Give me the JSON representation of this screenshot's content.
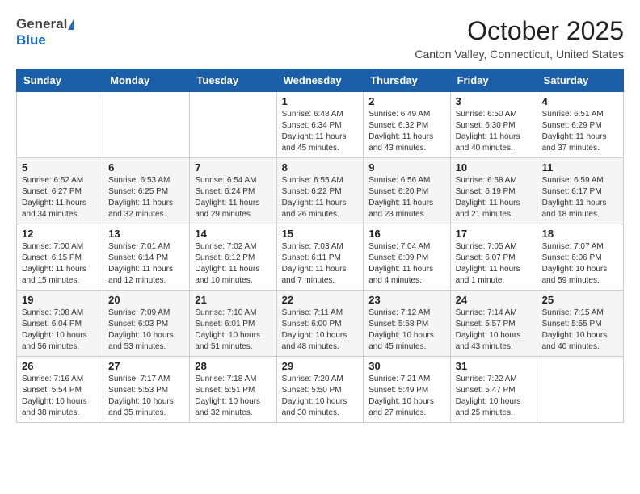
{
  "header": {
    "logo_general": "General",
    "logo_blue": "Blue",
    "month_title": "October 2025",
    "location": "Canton Valley, Connecticut, United States"
  },
  "weekdays": [
    "Sunday",
    "Monday",
    "Tuesday",
    "Wednesday",
    "Thursday",
    "Friday",
    "Saturday"
  ],
  "weeks": [
    [
      {
        "day": "",
        "info": ""
      },
      {
        "day": "",
        "info": ""
      },
      {
        "day": "",
        "info": ""
      },
      {
        "day": "1",
        "info": "Sunrise: 6:48 AM\nSunset: 6:34 PM\nDaylight: 11 hours and 45 minutes."
      },
      {
        "day": "2",
        "info": "Sunrise: 6:49 AM\nSunset: 6:32 PM\nDaylight: 11 hours and 43 minutes."
      },
      {
        "day": "3",
        "info": "Sunrise: 6:50 AM\nSunset: 6:30 PM\nDaylight: 11 hours and 40 minutes."
      },
      {
        "day": "4",
        "info": "Sunrise: 6:51 AM\nSunset: 6:29 PM\nDaylight: 11 hours and 37 minutes."
      }
    ],
    [
      {
        "day": "5",
        "info": "Sunrise: 6:52 AM\nSunset: 6:27 PM\nDaylight: 11 hours and 34 minutes."
      },
      {
        "day": "6",
        "info": "Sunrise: 6:53 AM\nSunset: 6:25 PM\nDaylight: 11 hours and 32 minutes."
      },
      {
        "day": "7",
        "info": "Sunrise: 6:54 AM\nSunset: 6:24 PM\nDaylight: 11 hours and 29 minutes."
      },
      {
        "day": "8",
        "info": "Sunrise: 6:55 AM\nSunset: 6:22 PM\nDaylight: 11 hours and 26 minutes."
      },
      {
        "day": "9",
        "info": "Sunrise: 6:56 AM\nSunset: 6:20 PM\nDaylight: 11 hours and 23 minutes."
      },
      {
        "day": "10",
        "info": "Sunrise: 6:58 AM\nSunset: 6:19 PM\nDaylight: 11 hours and 21 minutes."
      },
      {
        "day": "11",
        "info": "Sunrise: 6:59 AM\nSunset: 6:17 PM\nDaylight: 11 hours and 18 minutes."
      }
    ],
    [
      {
        "day": "12",
        "info": "Sunrise: 7:00 AM\nSunset: 6:15 PM\nDaylight: 11 hours and 15 minutes."
      },
      {
        "day": "13",
        "info": "Sunrise: 7:01 AM\nSunset: 6:14 PM\nDaylight: 11 hours and 12 minutes."
      },
      {
        "day": "14",
        "info": "Sunrise: 7:02 AM\nSunset: 6:12 PM\nDaylight: 11 hours and 10 minutes."
      },
      {
        "day": "15",
        "info": "Sunrise: 7:03 AM\nSunset: 6:11 PM\nDaylight: 11 hours and 7 minutes."
      },
      {
        "day": "16",
        "info": "Sunrise: 7:04 AM\nSunset: 6:09 PM\nDaylight: 11 hours and 4 minutes."
      },
      {
        "day": "17",
        "info": "Sunrise: 7:05 AM\nSunset: 6:07 PM\nDaylight: 11 hours and 1 minute."
      },
      {
        "day": "18",
        "info": "Sunrise: 7:07 AM\nSunset: 6:06 PM\nDaylight: 10 hours and 59 minutes."
      }
    ],
    [
      {
        "day": "19",
        "info": "Sunrise: 7:08 AM\nSunset: 6:04 PM\nDaylight: 10 hours and 56 minutes."
      },
      {
        "day": "20",
        "info": "Sunrise: 7:09 AM\nSunset: 6:03 PM\nDaylight: 10 hours and 53 minutes."
      },
      {
        "day": "21",
        "info": "Sunrise: 7:10 AM\nSunset: 6:01 PM\nDaylight: 10 hours and 51 minutes."
      },
      {
        "day": "22",
        "info": "Sunrise: 7:11 AM\nSunset: 6:00 PM\nDaylight: 10 hours and 48 minutes."
      },
      {
        "day": "23",
        "info": "Sunrise: 7:12 AM\nSunset: 5:58 PM\nDaylight: 10 hours and 45 minutes."
      },
      {
        "day": "24",
        "info": "Sunrise: 7:14 AM\nSunset: 5:57 PM\nDaylight: 10 hours and 43 minutes."
      },
      {
        "day": "25",
        "info": "Sunrise: 7:15 AM\nSunset: 5:55 PM\nDaylight: 10 hours and 40 minutes."
      }
    ],
    [
      {
        "day": "26",
        "info": "Sunrise: 7:16 AM\nSunset: 5:54 PM\nDaylight: 10 hours and 38 minutes."
      },
      {
        "day": "27",
        "info": "Sunrise: 7:17 AM\nSunset: 5:53 PM\nDaylight: 10 hours and 35 minutes."
      },
      {
        "day": "28",
        "info": "Sunrise: 7:18 AM\nSunset: 5:51 PM\nDaylight: 10 hours and 32 minutes."
      },
      {
        "day": "29",
        "info": "Sunrise: 7:20 AM\nSunset: 5:50 PM\nDaylight: 10 hours and 30 minutes."
      },
      {
        "day": "30",
        "info": "Sunrise: 7:21 AM\nSunset: 5:49 PM\nDaylight: 10 hours and 27 minutes."
      },
      {
        "day": "31",
        "info": "Sunrise: 7:22 AM\nSunset: 5:47 PM\nDaylight: 10 hours and 25 minutes."
      },
      {
        "day": "",
        "info": ""
      }
    ]
  ]
}
